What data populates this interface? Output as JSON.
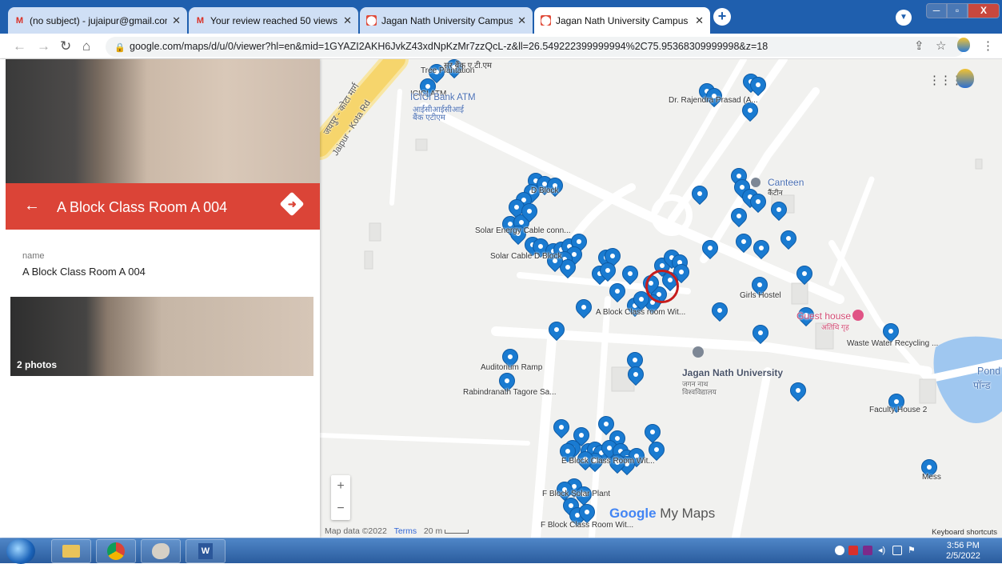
{
  "browser": {
    "tabs": [
      {
        "title": "(no subject) - jujaipur@gmail.com",
        "icon": "gmail-icon",
        "active": false
      },
      {
        "title": "Your review reached 50 views D",
        "icon": "gmail-icon",
        "active": false
      },
      {
        "title": "Jagan Nath University Campus -",
        "icon": "maps-icon",
        "active": false
      },
      {
        "title": "Jagan Nath University Campus -",
        "icon": "maps-icon",
        "active": true
      }
    ],
    "close_glyph": "✕",
    "new_tab": "+",
    "url": "google.com/maps/d/u/0/viewer?hl=en&mid=1GYAZI2AKH6JvkZ43xdNpKzMr7zzQcL-z&ll=26.549222399999994%2C75.95368309999998&z=18"
  },
  "sidebar": {
    "title": "A Block Class Room A 004",
    "field_label": "name",
    "field_value": "A Block Class Room A 004",
    "photos_count": "2 photos"
  },
  "map": {
    "labels": {
      "tree": "Tree Plantation",
      "atm_en": "ICICI ATM",
      "atm_en2": "ICICI Bank ATM",
      "atm_hi": "आईसीआईसीआई",
      "atm_hi2": "बैंक एटीएम",
      "top_hi": "सर बैंक ए.टी.एम",
      "road1": "Jaipur - Kota Rd",
      "road2": "जयपुर - कोटा मार्ग",
      "dblock": "D Block",
      "solar1": "Solar Energy Cable conn...",
      "solar2": "Solar Cable D Block",
      "rajendra": "Dr. Rajendra Prasad (A...",
      "canteen": "Canteen",
      "canteen_hi": "कैंटीन",
      "girls": "Girls Hostel",
      "guest": "Guest house",
      "guest_hi": "अतिथि गृह",
      "waste": "Waste Water Recycling ...",
      "ablock": "A Block Class room Wit...",
      "audit": "Auditorium Ramp",
      "tagore": "Rabindranath Tagore Sa...",
      "jnu": "Jagan Nath University",
      "jnu_hi1": "जगन नाथ",
      "jnu_hi2": "विश्वविद्यालय",
      "pond": "Pond",
      "pond_hi": "पॉन्ड",
      "faculty": "Faculty House 2",
      "mess": "Mess",
      "eblock": "E Block Class Room Wit...",
      "fsolar": "F Block Solar Plant",
      "fblock": "F Block Class Room Wit..."
    },
    "brand_google": "Google",
    "brand_mymaps": " My Maps",
    "attribution": "Map data ©2022",
    "terms": "Terms",
    "scale": "20 m",
    "keyboard": "Keyboard shortcuts",
    "zoom_in": "+",
    "zoom_out": "−"
  },
  "taskbar": {
    "time": "3:56 PM",
    "date": "2/5/2022"
  },
  "colors": {
    "header_red": "#db4437",
    "pin_blue": "#1a7bd1",
    "tab_bar": "#1f5fae"
  }
}
